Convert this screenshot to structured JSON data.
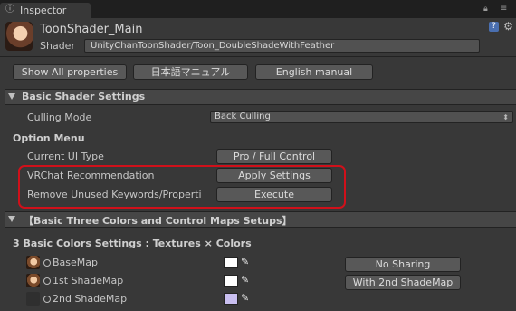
{
  "tab": {
    "label": "Inspector"
  },
  "header": {
    "material_name": "ToonShader_Main",
    "shader_label": "Shader",
    "shader_value": "UnityChanToonShader/Toon_DoubleShadeWithFeather"
  },
  "buttons": {
    "show_all": "Show All properties",
    "japanese_manual": "日本語マニュアル",
    "english_manual": "English manual"
  },
  "basic_settings": {
    "title": "Basic Shader Settings",
    "culling_label": "Culling Mode",
    "culling_value": "Back Culling"
  },
  "option_menu": {
    "title": "Option Menu",
    "ui_type_label": "Current UI Type",
    "ui_type_button": "Pro / Full Control",
    "vrchat_label": "VRChat Recommendation",
    "vrchat_button": "Apply Settings",
    "remove_label": "Remove Unused Keywords/Properti",
    "remove_button": "Execute"
  },
  "three_colors": {
    "title": "【Basic Three Colors and Control Maps Setups】",
    "subheading": "3 Basic Colors Settings : Textures × Colors",
    "rows": [
      {
        "label": "BaseMap",
        "has_texture": true,
        "color": "#ffffff"
      },
      {
        "label": "1st ShadeMap",
        "has_texture": true,
        "color": "#ffffff"
      },
      {
        "label": "2nd ShadeMap",
        "has_texture": false,
        "color": "#c9bff0"
      }
    ],
    "no_sharing_button": "No Sharing",
    "with_2nd_button": "With 2nd ShadeMap"
  },
  "colors": {
    "background": "#383838",
    "highlight_border": "#d0101a"
  }
}
